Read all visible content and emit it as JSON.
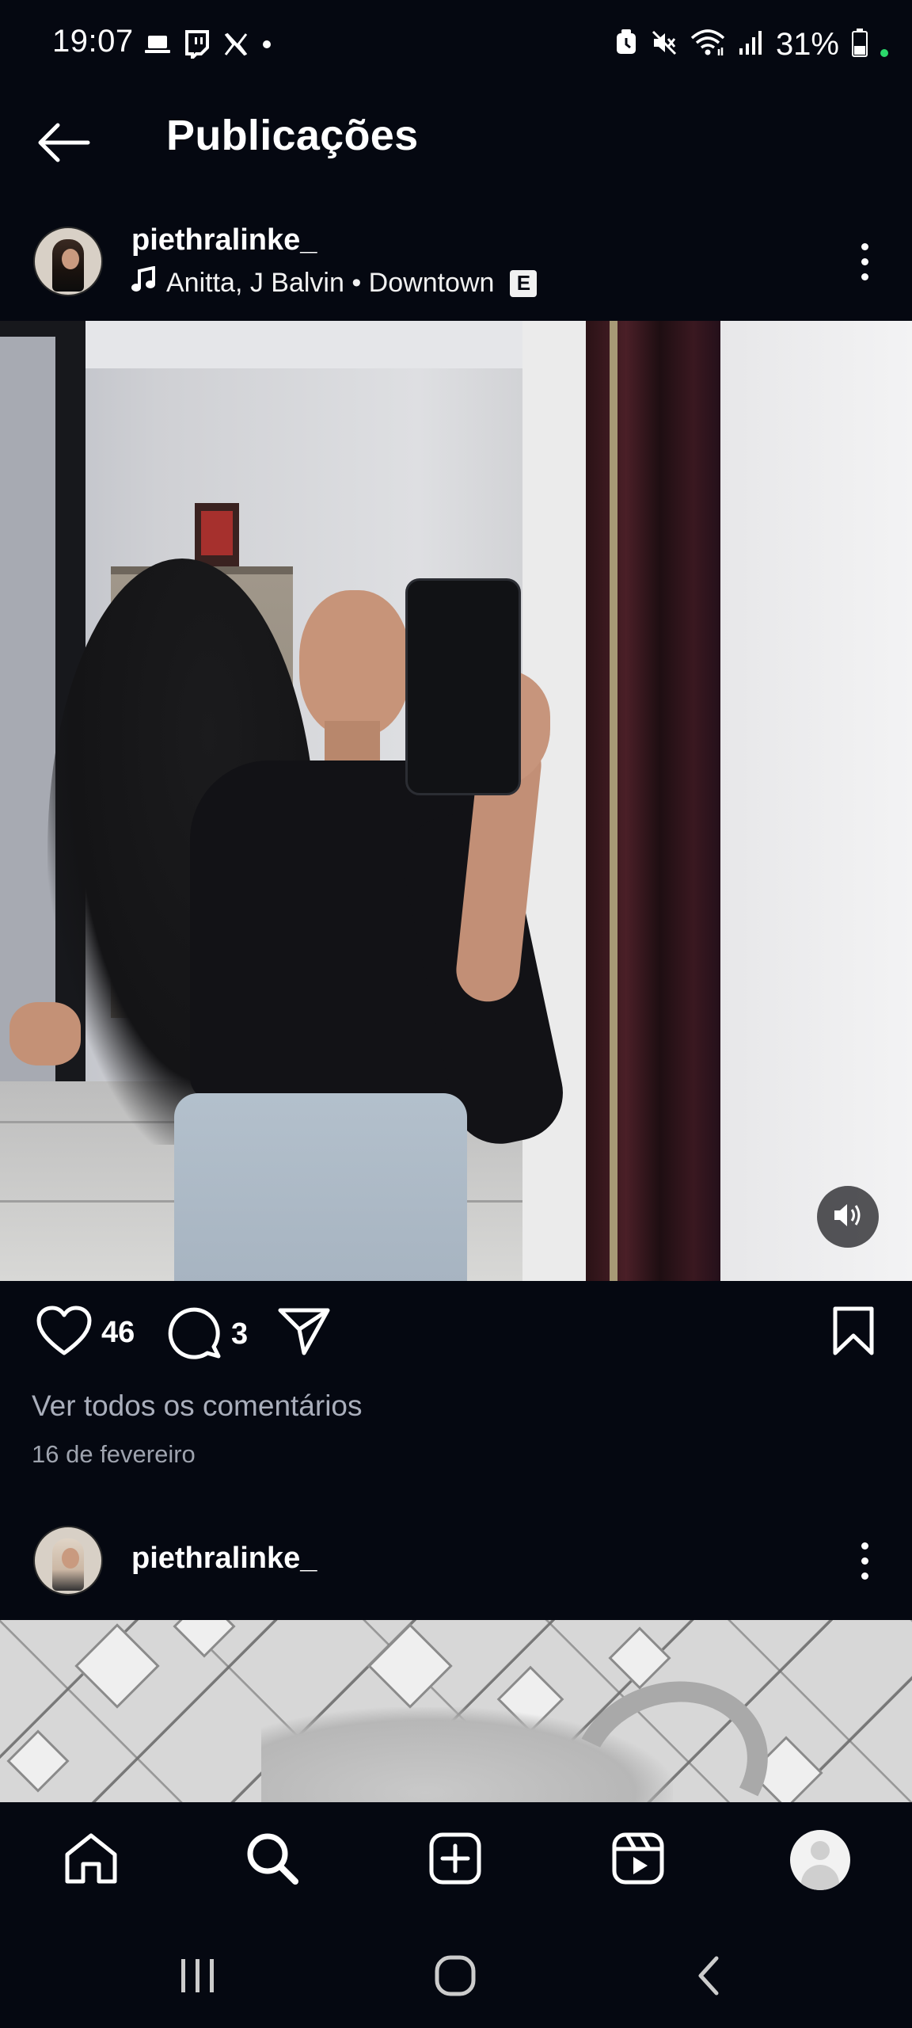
{
  "status_bar": {
    "time": "19:07",
    "battery_percent": "31%",
    "left_icons": [
      "laptop-icon",
      "twitch-icon",
      "x-icon",
      "dot-icon"
    ],
    "right_icons": [
      "alarm-icon",
      "mute-icon",
      "wifi-icon",
      "signal-icon",
      "battery-icon"
    ]
  },
  "header": {
    "title": "Publicações",
    "back_icon": "arrow-left-icon"
  },
  "post": {
    "username": "piethralinke_",
    "music": {
      "icon": "music-note-icon",
      "text": "Anitta, J Balvin • Downtown",
      "explicit": "E"
    },
    "media_alt": "mirror selfie",
    "likes": "46",
    "comments": "3",
    "view_comments": "Ver todos os comentários",
    "date": "16 de fevereiro"
  },
  "post2": {
    "username": "piethralinke_"
  },
  "bottom_nav": {
    "items": [
      "home-icon",
      "search-icon",
      "create-icon",
      "reels-icon",
      "profile-avatar"
    ]
  },
  "colors": {
    "background": "#050811",
    "secondary_text": "#a9aebb"
  }
}
